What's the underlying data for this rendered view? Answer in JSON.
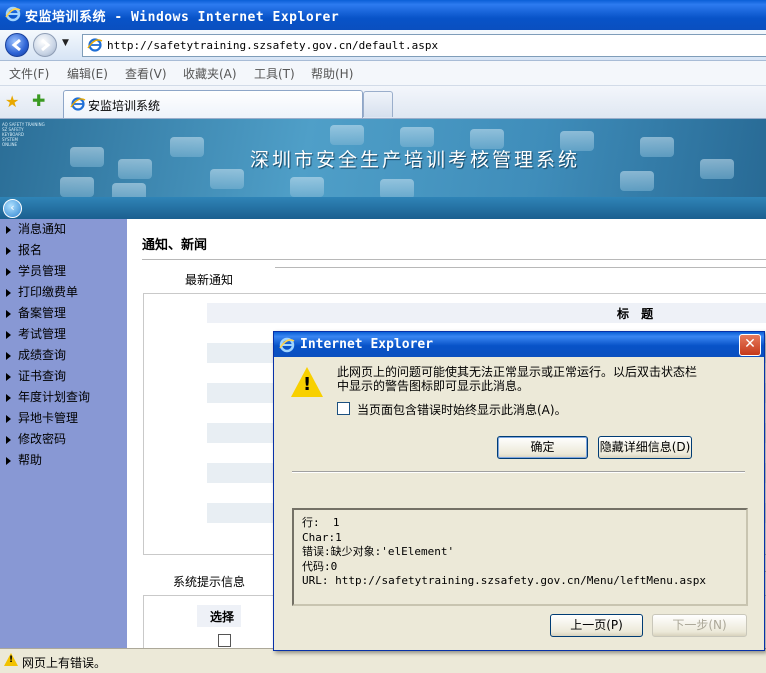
{
  "window": {
    "title": "安监培训系统 - Windows Internet Explorer"
  },
  "address": {
    "url": "http://safetytraining.szsafety.gov.cn/default.aspx"
  },
  "menu": [
    "文件(F)",
    "编辑(E)",
    "查看(V)",
    "收藏夹(A)",
    "工具(T)",
    "帮助(H)"
  ],
  "tab": {
    "label": "安监培训系统"
  },
  "banner": {
    "title": "深圳市安全生产培训考核管理系统",
    "lines": [
      "AQ SAFETY TRAINING",
      "SZ SAFETY",
      "KEYBOARD",
      "SYSTEM",
      "ONLINE"
    ]
  },
  "sidebar": {
    "items": [
      "消息通知",
      "报名",
      "学员管理",
      "打印缴费单",
      "备案管理",
      "考试管理",
      "成绩查询",
      "证书查询",
      "年度计划查询",
      "异地卡管理",
      "修改密码",
      "帮助"
    ]
  },
  "main": {
    "section_title": "通知、新闻",
    "latest_label": "最新通知",
    "column_title": "标 题",
    "system_label": "系统提示信息",
    "select_label": "选择"
  },
  "dialog": {
    "title": "Internet Explorer",
    "message": "此网页上的问题可能使其无法正常显示或正常运行。以后双击状态栏中显示的警告图标即可显示此消息。",
    "checkbox_label": "当页面包含错误时始终显示此消息(A)。",
    "ok_label": "确定",
    "hide_details_label": "隐藏详细信息(D)",
    "details": {
      "line": "行:  1",
      "char": "Char:1",
      "error": "错误:缺少对象:'elElement'",
      "code": "代码:0",
      "url": "URL: http://safetytraining.szsafety.gov.cn/Menu/leftMenu.aspx"
    },
    "prev_label": "上一页(P)",
    "next_label": "下一步(N)"
  },
  "status": {
    "text": "网页上有错误。"
  },
  "colors": {
    "titlebar": "#0a5fd6",
    "sidebar": "#8898d4",
    "banner": "#4f9fc8"
  },
  "icons": [
    "ie-icon",
    "back-arrow-icon",
    "forward-arrow-icon",
    "favorites-star-icon",
    "add-favorite-icon",
    "collapse-icon",
    "warning-icon",
    "close-icon"
  ]
}
